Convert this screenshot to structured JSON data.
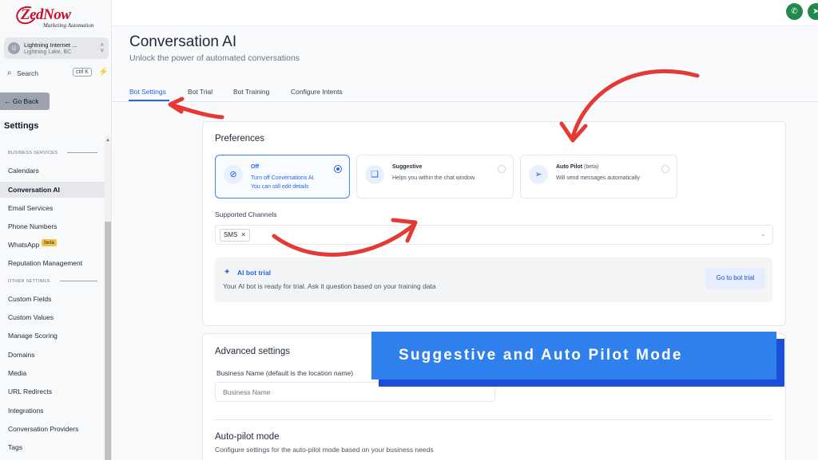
{
  "brand": {
    "logo_text": "ZedNow",
    "logo_tagline": "Marketing Automation"
  },
  "location": {
    "name": "Lightning Internet ...",
    "sub": "Lightning Lake, BC"
  },
  "search": {
    "label": "Search",
    "shortcut": "ctrl K"
  },
  "sidebar": {
    "back_label": "← Go Back",
    "title": "Settings",
    "sections": [
      {
        "label": "BUSINESS SERVICES"
      },
      {
        "label": "OTHER SETTINGS"
      }
    ],
    "items": [
      {
        "label": "Calendars"
      },
      {
        "label": "Conversation AI"
      },
      {
        "label": "Email Services"
      },
      {
        "label": "Phone Numbers"
      },
      {
        "label": "WhatsApp",
        "badge": "beta"
      },
      {
        "label": "Reputation Management"
      },
      {
        "label": "Custom Fields"
      },
      {
        "label": "Custom Values"
      },
      {
        "label": "Manage Scoring"
      },
      {
        "label": "Domains"
      },
      {
        "label": "Media"
      },
      {
        "label": "URL Redirects"
      },
      {
        "label": "Integrations"
      },
      {
        "label": "Conversation Providers"
      },
      {
        "label": "Tags"
      }
    ]
  },
  "page": {
    "title": "Conversation AI",
    "subtitle": "Unlock the power of automated conversations"
  },
  "tabs": [
    {
      "label": "Bot Settings",
      "active": true
    },
    {
      "label": "Bot Trial"
    },
    {
      "label": "Bot Training"
    },
    {
      "label": "Configure Intents"
    }
  ],
  "preferences": {
    "title": "Preferences",
    "modes": [
      {
        "title": "Off",
        "desc1": "Turn off Conversations AI.",
        "desc2": "You can still edit details",
        "selected": true,
        "icon": "bot-off-icon"
      },
      {
        "title": "Suggestive",
        "desc1": "Helps you within the chat window.",
        "selected": false,
        "icon": "chat-bubbles-icon"
      },
      {
        "title": "Auto Pilot",
        "suffix": "(beta)",
        "desc1": "Will send messages automatically",
        "selected": false,
        "icon": "send-icon"
      }
    ],
    "channels_label": "Supported Channels",
    "channels": [
      "SMS"
    ],
    "trial": {
      "title": "AI bot trial",
      "desc": "Your AI bot is ready for trial. Ask it question based on your training data",
      "button": "Go to bot trial"
    }
  },
  "advanced": {
    "title": "Advanced settings",
    "business_name_label": "Business Name (default is the location name)",
    "business_name_placeholder": "Business Name",
    "autopilot_title": "Auto-pilot mode",
    "autopilot_desc": "Configure settings for the auto-pilot mode based on your business needs"
  },
  "overlay": {
    "banner": "Suggestive and Auto Pilot Mode"
  },
  "colors": {
    "accent": "#2563eb",
    "banner": "#2f80ed",
    "arrow": "#e53935",
    "brand": "#c8102e",
    "phone": "#1f8a4c"
  }
}
